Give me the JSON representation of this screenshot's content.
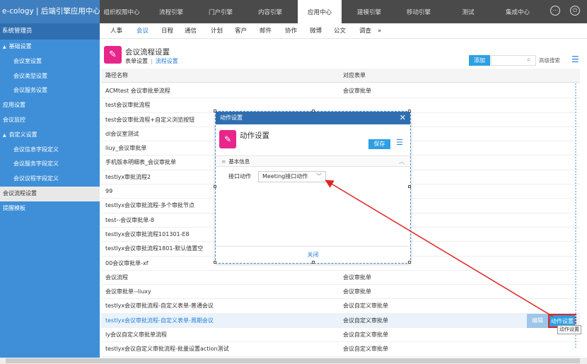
{
  "app": {
    "brand": "e-cology | 后端引擎应用中心"
  },
  "topnav": [
    "组织权限中心",
    "流程引擎",
    "门户引擎",
    "内容引擎",
    "应用中心",
    "建模引擎",
    "移动引擎",
    "测试",
    "集成中心"
  ],
  "topnav_active": 4,
  "topicons": [
    "more-icon",
    "power-icon"
  ],
  "sidebar": {
    "user": "系统管理员",
    "items": [
      {
        "label": "基础设置",
        "level": 0,
        "tri": "▲"
      },
      {
        "label": "会议室设置",
        "level": 1
      },
      {
        "label": "会议类型设置",
        "level": 1
      },
      {
        "label": "会议服务设置",
        "level": 1
      },
      {
        "label": "应用设置",
        "level": "sec"
      },
      {
        "label": "会议监控",
        "level": "sec"
      },
      {
        "label": "自定义设置",
        "level": 0,
        "tri": "▲"
      },
      {
        "label": "会议信息字段定义",
        "level": 1
      },
      {
        "label": "会议服务字段定义",
        "level": 1
      },
      {
        "label": "会议议程字段定义",
        "level": 1
      },
      {
        "label": "会议流程设置",
        "level": "sec",
        "active": true
      },
      {
        "label": "提醒模板",
        "level": "sec"
      }
    ]
  },
  "submenu": [
    "人事",
    "会议",
    "日程",
    "通信",
    "计划",
    "客户",
    "邮件",
    "协作",
    "微博",
    "公文",
    "调查",
    "»"
  ],
  "submenu_active": 1,
  "page": {
    "title": "会议流程设置",
    "tab_form": "表单设置",
    "tab_sep": "|",
    "tab_flow": "流程设置",
    "add_label": "添加",
    "search_placeholder": "",
    "adv_search": "高级搜索"
  },
  "table": {
    "headers": [
      "路径名称",
      "对应表单"
    ],
    "rows": [
      [
        "ACMtest 会议审批单流程",
        "会议审批单"
      ],
      [
        "test会议审批流程",
        ""
      ],
      [
        "test会议审批流程+自定义浏览按钮",
        ""
      ],
      [
        "dl会议室测试",
        ""
      ],
      [
        "liuy_会议审批单",
        ""
      ],
      [
        "手机版本明细表_会议审批单",
        ""
      ],
      [
        "testlyx审批流程2",
        ""
      ],
      [
        "99",
        ""
      ],
      [
        "testlyx会议审批流程-多个审批节点",
        ""
      ],
      [
        "test--会议审批单-8",
        ""
      ],
      [
        "testlyx会议审批流程101301-E8",
        ""
      ],
      [
        "testlyx会议审批流程1801-默认值置空",
        ""
      ],
      [
        "00会议审批单-xf",
        ""
      ],
      [
        "会议流程",
        "会议审批单"
      ],
      [
        "会议审批单--liuxy",
        "会议审批单"
      ],
      [
        "testlyx会议审批流程-自定义表单-普通会议",
        "会议自定义审批单"
      ],
      [
        "testlyx会议审批流程-自定义表单-周期会议",
        "会议自定义审批单"
      ],
      [
        "ly会议自定义审批单流程",
        "会议自定义审批单"
      ],
      [
        "testlyx会议自定义审批流程-批量设置action测试",
        "会议自定义审批单"
      ]
    ],
    "highlight_row": 16,
    "edit_label": "编辑",
    "action_label": "动作设置",
    "tooltip": "动作设置"
  },
  "modal": {
    "header": "动作设置",
    "close": "✕",
    "title": "动作设置",
    "save_label": "保存",
    "section": "基本信息",
    "field_label": "接口动作",
    "field_value": "Meeting接口动作",
    "footer": "关闭"
  },
  "colors": {
    "accent": "#2da0e3",
    "sidebar": "#3e8fd8",
    "topbar": "#4a4a4a",
    "icon_pink": "#e8258b",
    "annotation_red": "#e02424"
  }
}
